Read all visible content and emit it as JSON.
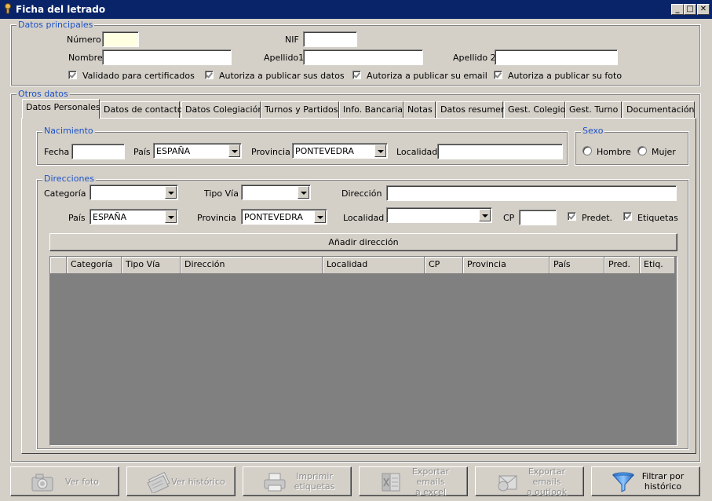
{
  "window": {
    "title": "Ficha del letrado",
    "minimize": "_",
    "maximize": "□",
    "close": "✕"
  },
  "datos_principales": {
    "legend": "Datos principales",
    "numero_label": "Número",
    "numero_value": "",
    "nif_label": "NIF",
    "nif_value": "",
    "nombre_label": "Nombre",
    "nombre_value": "",
    "apellido1_label": "Apellido1",
    "apellido1_value": "",
    "apellido2_label": "Apellido 2",
    "apellido2_value": "",
    "checks": [
      {
        "label": "Validado para certificados",
        "checked": true
      },
      {
        "label": "Autoriza a publicar sus datos",
        "checked": true
      },
      {
        "label": "Autoriza a publicar su email",
        "checked": true
      },
      {
        "label": "Autoriza a publicar su foto",
        "checked": true
      }
    ]
  },
  "otros_datos": {
    "legend": "Otros datos",
    "tabs": [
      {
        "label": "Datos Personales",
        "active": true
      },
      {
        "label": "Datos de contacto"
      },
      {
        "label": "Datos Colegiación"
      },
      {
        "label": "Turnos y Partidos"
      },
      {
        "label": "Info. Bancaria"
      },
      {
        "label": "Notas"
      },
      {
        "label": "Datos resumen"
      },
      {
        "label": "Gest. Colegio"
      },
      {
        "label": "Gest. Turno"
      },
      {
        "label": "Documentación"
      }
    ]
  },
  "nacimiento": {
    "legend": "Nacimiento",
    "fecha_label": "Fecha",
    "fecha_value": "",
    "pais_label": "País",
    "pais_value": "ESPAÑA",
    "provincia_label": "Provincia",
    "provincia_value": "PONTEVEDRA",
    "localidad_label": "Localidad",
    "localidad_value": ""
  },
  "sexo": {
    "legend": "Sexo",
    "hombre": "Hombre",
    "mujer": "Mujer"
  },
  "direcciones": {
    "legend": "Direcciones",
    "categoria_label": "Categoría",
    "categoria_value": "",
    "tipo_via_label": "Tipo Vía",
    "tipo_via_value": "",
    "direccion_label": "Dirección",
    "direccion_value": "",
    "pais_label": "País",
    "pais_value": "ESPAÑA",
    "provincia_label": "Provincia",
    "provincia_value": "PONTEVEDRA",
    "localidad_label": "Localidad",
    "localidad_value": "",
    "cp_label": "CP",
    "cp_value": "",
    "predet_label": "Predet.",
    "predet_checked": true,
    "etiquetas_label": "Etiquetas",
    "etiquetas_checked": true,
    "add_button": "Añadir dirección",
    "columns": [
      "Categoría",
      "Tipo Vía",
      "Dirección",
      "Localidad",
      "CP",
      "Provincia",
      "País",
      "Pred.",
      "Etiq."
    ],
    "rows": []
  },
  "bottom_buttons": [
    {
      "label": "Ver foto",
      "icon": "camera-icon",
      "enabled": false
    },
    {
      "label": "Ver histórico",
      "icon": "history-icon",
      "enabled": false
    },
    {
      "label": "Imprimir etiquetas",
      "icon": "printer-icon",
      "enabled": false
    },
    {
      "label": "Exportar emails\na excel",
      "icon": "excel-icon",
      "enabled": false
    },
    {
      "label": "Exportar emails\na outlook",
      "icon": "outlook-icon",
      "enabled": false
    },
    {
      "label": "Filtrar por\nhistórico",
      "icon": "funnel-icon",
      "enabled": true
    }
  ],
  "colors": {
    "title_bar": "#0a246a",
    "legend_text": "#1c52c8",
    "grid_bg": "#808080",
    "face": "#d4d0c8",
    "numero_bg": "#ffffe1"
  }
}
